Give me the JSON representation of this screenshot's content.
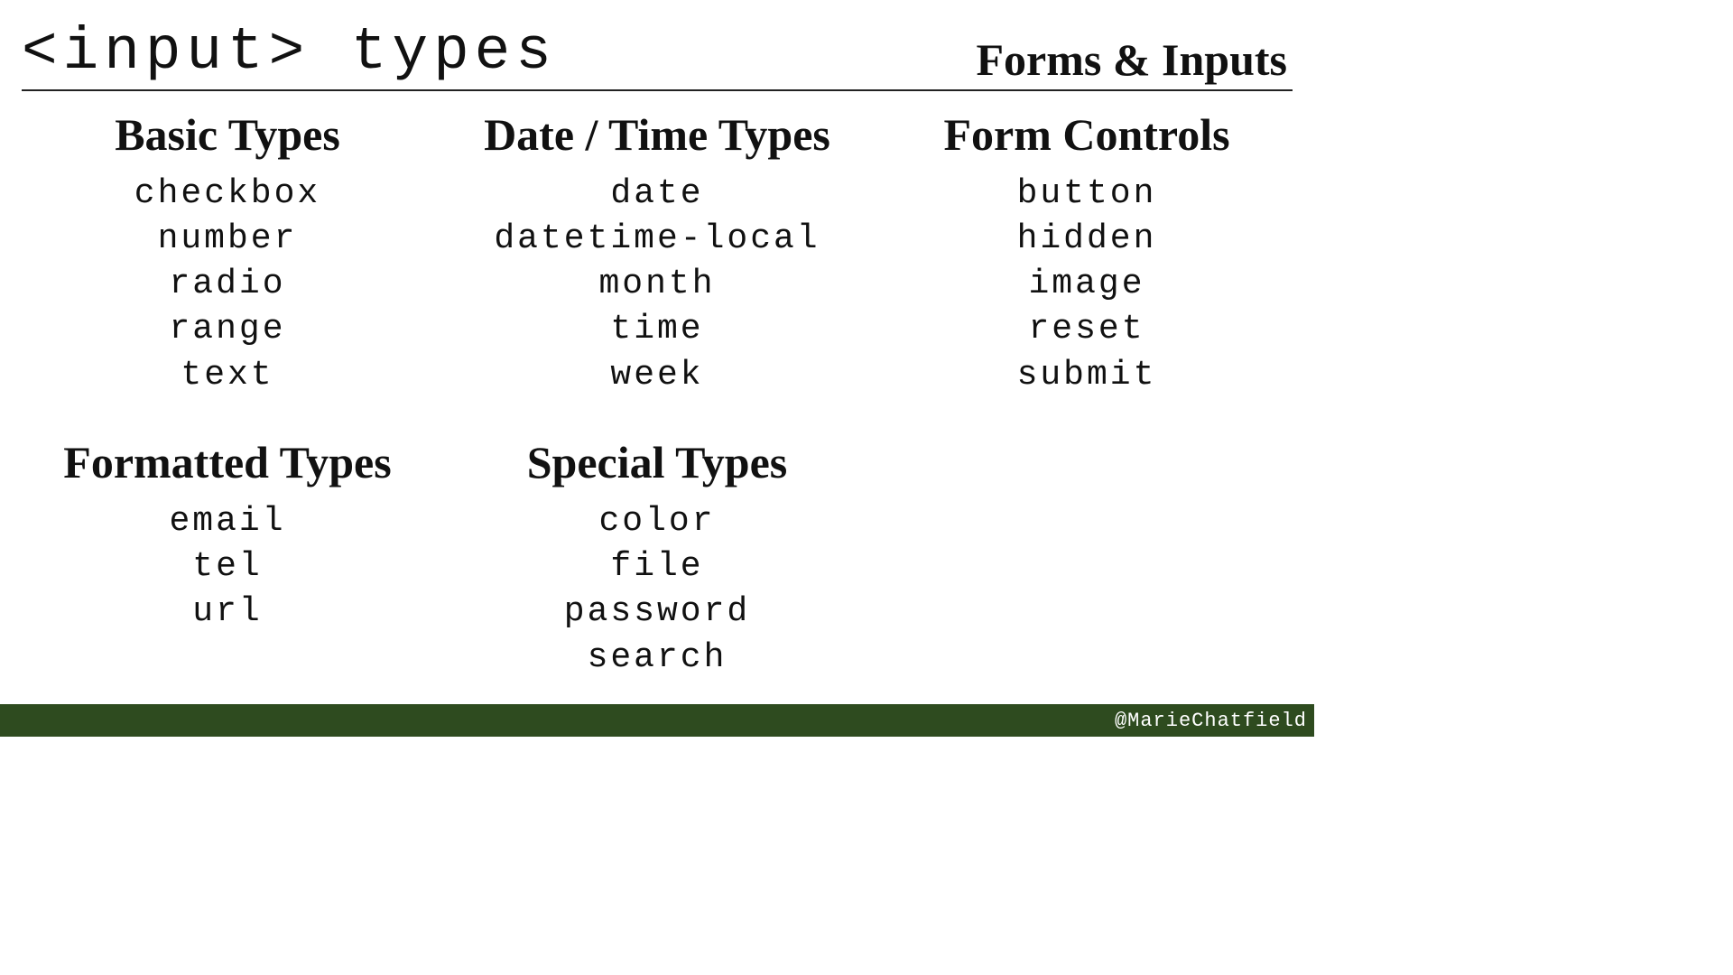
{
  "header": {
    "title": "<input> types",
    "subtitle": "Forms & Inputs"
  },
  "groups": [
    {
      "heading": "Basic Types",
      "items": [
        "checkbox",
        "number",
        "radio",
        "range",
        "text"
      ]
    },
    {
      "heading": "Date / Time Types",
      "items": [
        "date",
        "datetime-local",
        "month",
        "time",
        "week"
      ]
    },
    {
      "heading": "Form Controls",
      "items": [
        "button",
        "hidden",
        "image",
        "reset",
        "submit"
      ]
    },
    {
      "heading": "Formatted Types",
      "items": [
        "email",
        "tel",
        "url"
      ]
    },
    {
      "heading": "Special Types",
      "items": [
        "color",
        "file",
        "password",
        "search"
      ]
    }
  ],
  "footer": {
    "handle": "@MarieChatfield"
  }
}
